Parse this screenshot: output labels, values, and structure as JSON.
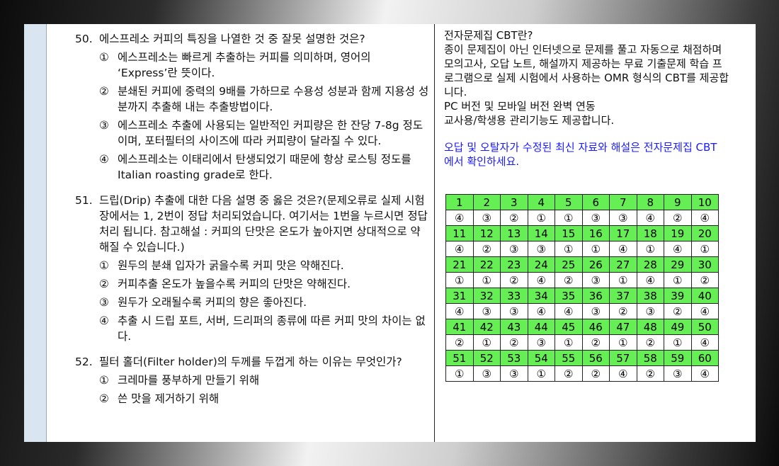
{
  "questions": [
    {
      "number": "50.",
      "stem": "에스프레소 커피의 특징을 나열한 것 중 잘못 설명한 것은?",
      "choices": [
        {
          "mark": "①",
          "text": "에스프레소는 빠르게 추출하는 커피를 의미하며, 영어의 ‘Express’란 뜻이다."
        },
        {
          "mark": "②",
          "text": "분쇄된 커피에 중력의 9배를 가하므로 수용성 성분과 함께 지용성 성분까지 추출해 내는 추출방법이다."
        },
        {
          "mark": "③",
          "text": "에스프레소 추출에 사용되는 일반적인 커피량은 한 잔당 7-8g 정도이며, 포터필터의 사이즈에 따라 커피량이 달라질 수 있다."
        },
        {
          "mark": "④",
          "text": "에스프레소는 이태리에서 탄생되었기 때문에 항상 로스팅 정도를 Italian roasting grade로 한다."
        }
      ]
    },
    {
      "number": "51.",
      "stem": "드립(Drip) 추출에 대한 다음 설명 중 옳은 것은?(문제오류로 실제 시험장에서는 1, 2번이 정답 처리되었습니다. 여기서는 1번을 누르시면 정답 처리 됩니다. 참고해설 : 커피의 단맛은 온도가 높아지면 상대적으로 약해질 수 있습니다.)",
      "choices": [
        {
          "mark": "①",
          "text": "원두의 분쇄 입자가 굵을수록 커피 맛은 약해진다."
        },
        {
          "mark": "②",
          "text": "커피추출 온도가 높을수록 커피의 단맛은 약해진다."
        },
        {
          "mark": "③",
          "text": "원두가 오래될수록 커피의 향은 좋아진다."
        },
        {
          "mark": "④",
          "text": "추출 시 드립 포트, 서버, 드리퍼의 종류에 따른 커피 맛의 차이는 없다."
        }
      ]
    },
    {
      "number": "52.",
      "stem": "필터 홀더(Filter holder)의 두께를 두껍게 하는 이유는 무엇인가?",
      "choices": [
        {
          "mark": "①",
          "text": "크레마를 풍부하게 만들기 위해"
        },
        {
          "mark": "②",
          "text": "쓴 맛을 제거하기 위해"
        }
      ]
    }
  ],
  "info": {
    "lines": [
      "전자문제집 CBT란?",
      "종이 문제집이 아닌 인터넷으로 문제를 풀고 자동으로 채점하며",
      "모의고사, 오답 노트, 해설까지 제공하는 무료 기출문제 학습 프",
      "로그램으로 실제 시험에서 사용하는 OMR 형식의 CBT를 제공합",
      "니다.",
      "PC 버전 및 모바일 버전 완벽 연동",
      "교사용/학생용 관리기능도 제공합니다."
    ],
    "notice_lines": [
      "오답 및 오탈자가 수정된 최신 자료와 해설은 전자문제집 CBT",
      "에서 확인하세요."
    ]
  },
  "answer_table": [
    {
      "numbers": [
        "1",
        "2",
        "3",
        "4",
        "5",
        "6",
        "7",
        "8",
        "9",
        "10"
      ],
      "answers": [
        "④",
        "③",
        "②",
        "①",
        "①",
        "③",
        "③",
        "④",
        "②",
        "④"
      ]
    },
    {
      "numbers": [
        "11",
        "12",
        "13",
        "14",
        "15",
        "16",
        "17",
        "18",
        "19",
        "20"
      ],
      "answers": [
        "④",
        "②",
        "③",
        "③",
        "①",
        "①",
        "④",
        "①",
        "④",
        "①"
      ]
    },
    {
      "numbers": [
        "21",
        "22",
        "23",
        "24",
        "25",
        "26",
        "27",
        "28",
        "29",
        "30"
      ],
      "answers": [
        "①",
        "①",
        "②",
        "④",
        "②",
        "③",
        "①",
        "④",
        "①",
        "②"
      ]
    },
    {
      "numbers": [
        "31",
        "32",
        "33",
        "34",
        "35",
        "36",
        "37",
        "38",
        "39",
        "40"
      ],
      "answers": [
        "④",
        "③",
        "③",
        "④",
        "④",
        "③",
        "②",
        "③",
        "②",
        "④"
      ]
    },
    {
      "numbers": [
        "41",
        "42",
        "43",
        "44",
        "45",
        "46",
        "47",
        "48",
        "49",
        "50"
      ],
      "answers": [
        "②",
        "①",
        "②",
        "③",
        "①",
        "②",
        "①",
        "②",
        "①",
        "④"
      ]
    },
    {
      "numbers": [
        "51",
        "52",
        "53",
        "54",
        "55",
        "56",
        "57",
        "58",
        "59",
        "60"
      ],
      "answers": [
        "①",
        "③",
        "③",
        "①",
        "②",
        "②",
        "④",
        "②",
        "③",
        "④"
      ]
    }
  ],
  "colors": {
    "number_row_bg": "#66ee55",
    "notice_text": "#1a1aff",
    "left_strip": "#d9e6f1"
  }
}
